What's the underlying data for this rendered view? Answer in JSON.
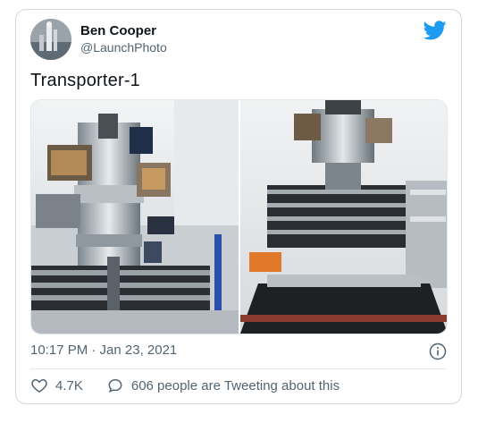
{
  "author": {
    "name": "Ben Cooper",
    "handle": "@LaunchPhoto"
  },
  "tweet": {
    "text": "Transporter-1",
    "timestamp": "10:17 PM · Jan 23, 2021"
  },
  "stats": {
    "likes": "4.7K",
    "conversation": "606 people are Tweeting about this"
  },
  "icons": {
    "brand": "twitter-bird-icon",
    "info": "info-icon",
    "like": "heart-icon",
    "reply": "speech-bubble-icon"
  },
  "colors": {
    "brand": "#1d9bf0",
    "secondary_text": "#536471",
    "border": "#cfd9de"
  }
}
